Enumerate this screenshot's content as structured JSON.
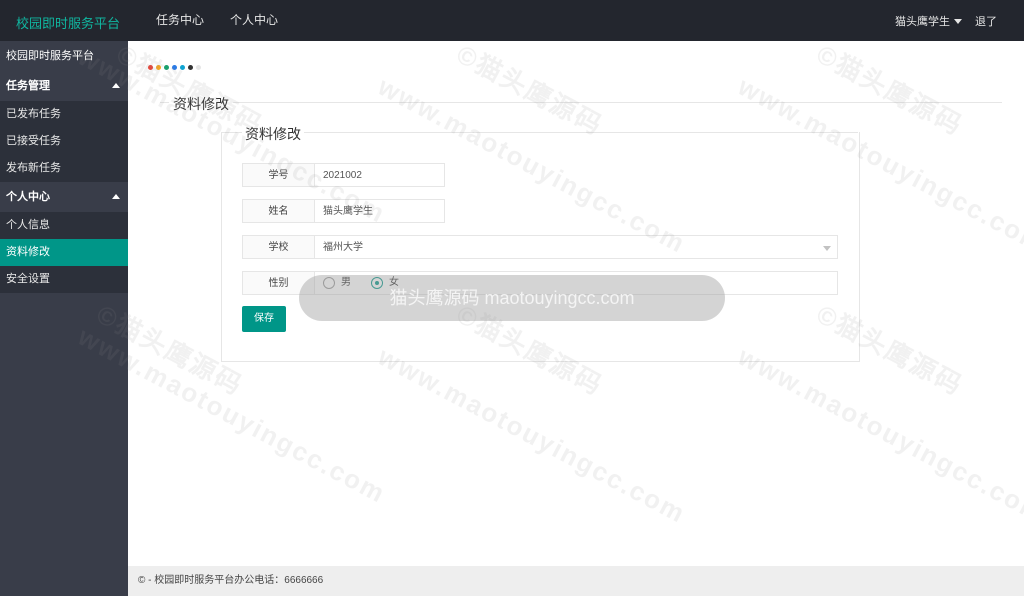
{
  "app": {
    "brand": "校园即时服务平台"
  },
  "topnav": {
    "items": [
      "任务中心",
      "个人中心"
    ]
  },
  "user": {
    "name": "猫头鹰学生",
    "logout": "退了"
  },
  "sidebar": {
    "title": "校园即时服务平台",
    "groups": [
      {
        "label": "任务管理",
        "items": [
          "已发布任务",
          "已接受任务",
          "发布新任务"
        ]
      },
      {
        "label": "个人中心",
        "items": [
          "个人信息",
          "资料修改",
          "安全设置"
        ]
      }
    ],
    "active_item": "资料修改"
  },
  "page": {
    "section_title": "资料修改",
    "form_title": "资料修改",
    "dot_colors": [
      "#e8463a",
      "#f5a623",
      "#1aa06d",
      "#2c7be5",
      "#0fa3d1",
      "#333333",
      "#e6e6e6"
    ]
  },
  "form": {
    "student_id": {
      "label": "学号",
      "value": "2021002"
    },
    "name": {
      "label": "姓名",
      "value": "猫头鹰学生"
    },
    "school": {
      "label": "学校",
      "value": "福州大学"
    },
    "gender": {
      "label": "性别",
      "options": [
        "男",
        "女"
      ],
      "selected": "女"
    },
    "save_label": "保存"
  },
  "footer": {
    "text": "© - 校园即时服务平台办公电话：6666666"
  },
  "overlay": {
    "watermark": "www.maotouyingcc.com",
    "watermark_cn": "©猫头鹰源码",
    "toast": "猫头鹰源码 maotouyingcc.com"
  },
  "colors": {
    "accent": "#009688",
    "topbar": "#23262e",
    "sidebar": "#393d49",
    "brand": "#10b6a0"
  }
}
